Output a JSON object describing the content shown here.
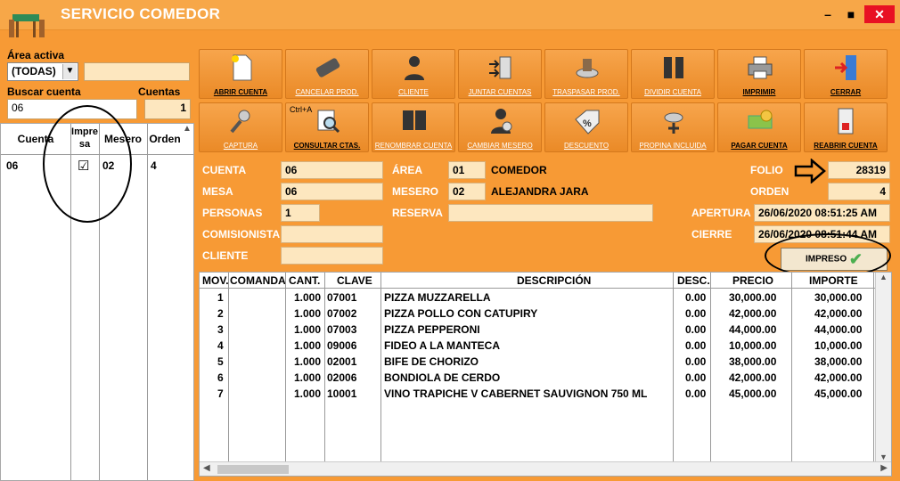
{
  "window": {
    "title": "SERVICIO COMEDOR",
    "minimize": "–",
    "maximize": "■",
    "close": "✕"
  },
  "left": {
    "area_label": "Área activa",
    "area_value": "(TODAS)",
    "buscar_label": "Buscar cuenta",
    "buscar_value": "06",
    "cuentas_label": "Cuentas",
    "cuentas_value": "1",
    "columns": [
      "Cuenta",
      "Impresa",
      "Mesero",
      "Orden"
    ],
    "rows": [
      {
        "cuenta": "06",
        "impresa": "☑",
        "mesero": "02",
        "orden": "4"
      }
    ]
  },
  "toolbar": {
    "row1": [
      "ABRIR CUENTA",
      "CANCELAR PROD.",
      "CLIENTE",
      "JUNTAR CUENTAS",
      "TRASPASAR PROD.",
      "DIVIDIR CUENTA",
      "IMPRIMIR",
      "CERRAR"
    ],
    "row2": [
      "CAPTURA",
      "CONSULTAR CTAS.",
      "RENOMBRAR CUENTA",
      "CAMBIAR MESERO",
      "DESCUENTO",
      "PROPINA INCLUIDA",
      "PAGAR CUENTA",
      "REABRIR CUENTA"
    ],
    "hotkey": "Ctrl+A"
  },
  "info": {
    "cuenta_label": "CUENTA",
    "cuenta": "06",
    "mesa_label": "MESA",
    "mesa": "06",
    "personas_label": "PERSONAS",
    "personas": "1",
    "comisionista_label": "COMISIONISTA",
    "comisionista": "",
    "cliente_label": "CLIENTE",
    "cliente": "",
    "area_label": "ÁREA",
    "area_code": "01",
    "area_name": "COMEDOR",
    "mesero_label": "MESERO",
    "mesero_code": "02",
    "mesero_name": "ALEJANDRA JARA",
    "reserva_label": "RESERVA",
    "reserva": "",
    "folio_label": "FOLIO",
    "folio": "28319",
    "orden_label": "ORDEN",
    "orden": "4",
    "apertura_label": "APERTURA",
    "apertura": "26/06/2020 08:51:25 AM",
    "cierre_label": "CIERRE",
    "cierre": "26/06/2020 08:51:44 AM",
    "impreso": "IMPRESO"
  },
  "grid": {
    "columns": [
      "MOV.",
      "COMANDA",
      "CANT.",
      "CLAVE",
      "DESCRIPCIÓN",
      "DESC.",
      "PRECIO",
      "IMPORTE"
    ],
    "rows": [
      {
        "mov": "1",
        "comanda": "",
        "cant": "1.000",
        "clave": "07001",
        "desc": "PIZZA MUZZARELLA",
        "dsc": "0.00",
        "precio": "30,000.00",
        "importe": "30,000.00"
      },
      {
        "mov": "2",
        "comanda": "",
        "cant": "1.000",
        "clave": "07002",
        "desc": "PIZZA POLLO CON CATUPIRY",
        "dsc": "0.00",
        "precio": "42,000.00",
        "importe": "42,000.00"
      },
      {
        "mov": "3",
        "comanda": "",
        "cant": "1.000",
        "clave": "07003",
        "desc": "PIZZA PEPPERONI",
        "dsc": "0.00",
        "precio": "44,000.00",
        "importe": "44,000.00"
      },
      {
        "mov": "4",
        "comanda": "",
        "cant": "1.000",
        "clave": "09006",
        "desc": "FIDEO A LA MANTECA",
        "dsc": "0.00",
        "precio": "10,000.00",
        "importe": "10,000.00"
      },
      {
        "mov": "5",
        "comanda": "",
        "cant": "1.000",
        "clave": "02001",
        "desc": "BIFE DE CHORIZO",
        "dsc": "0.00",
        "precio": "38,000.00",
        "importe": "38,000.00"
      },
      {
        "mov": "6",
        "comanda": "",
        "cant": "1.000",
        "clave": "02006",
        "desc": "BONDIOLA DE CERDO",
        "dsc": "0.00",
        "precio": "42,000.00",
        "importe": "42,000.00"
      },
      {
        "mov": "7",
        "comanda": "",
        "cant": "1.000",
        "clave": "10001",
        "desc": "VINO TRAPICHE V CABERNET SAUVIGNON 750 ML",
        "dsc": "0.00",
        "precio": "45,000.00",
        "importe": "45,000.00"
      }
    ]
  }
}
